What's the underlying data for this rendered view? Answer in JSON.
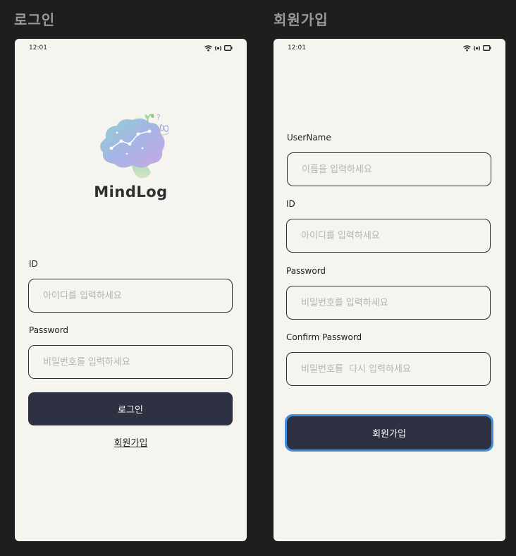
{
  "frames": {
    "login_title": "로그인",
    "signup_title": "회원가입"
  },
  "status_bar": {
    "time": "12:01",
    "icons": [
      "wifi-icon",
      "signal-icon",
      "battery-icon"
    ]
  },
  "login": {
    "logo_text": "MindLog",
    "id_label": "ID",
    "id_placeholder": "아이디를 입력하세요",
    "password_label": "Password",
    "password_placeholder": "비밀번호를 입력하세요",
    "login_button": "로그인",
    "signup_link": "회원가입"
  },
  "signup": {
    "username_label": "UserName",
    "username_placeholder": "이름을 입력하세요",
    "id_label": "ID",
    "id_placeholder": "아이디를 입력하세요",
    "password_label": "Password",
    "password_placeholder": "비밀번호를 입력하세요",
    "confirm_label": "Confirm Password",
    "confirm_placeholder": "비밀번호를  다시 입력하세요",
    "signup_button": "회원가입"
  },
  "colors": {
    "background": "#1e1e1e",
    "screen": "#f6f4ef",
    "button": "#2d3142",
    "focus_ring": "#3f8ee0"
  }
}
